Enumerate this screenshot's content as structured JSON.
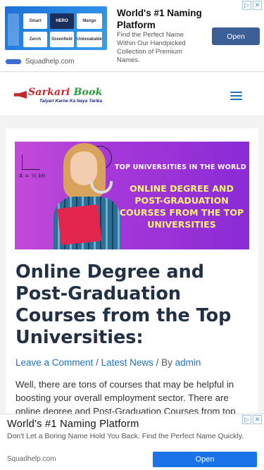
{
  "ad_top": {
    "title": "World's #1 Naming Platform",
    "description": "Find the Perfect Name Within Our Handpicked Collection of Premium Names.",
    "cta": "Open",
    "site": "Squadhelp.com",
    "thumb_tiles": [
      "Smart",
      "HERO",
      "Mango",
      "Zerch",
      "Greenfield",
      "Unbreakable"
    ],
    "adchoice_icons": [
      "info-icon",
      "close-icon"
    ]
  },
  "header": {
    "logo_name_a": "Sarkari ",
    "logo_name_b": "Book",
    "logo_tagline": "Taiyari Karne Ka Naya Tarika",
    "menu_icon": "hamburger-icon",
    "accent": "#1e73be"
  },
  "article": {
    "hero_top_text": "TOP UNIVERSITIES IN THE WORLD",
    "hero_main_text": "ONLINE DEGREE AND POST-GRADUATION COURSES FROM THE TOP UNIVERSITIES",
    "headline": "Online Degree and Post-Graduation Courses from the Top Universities:",
    "comment_link": "Leave a Comment",
    "separator_1": " / ",
    "category_link": "Latest News",
    "by_text": " / By ",
    "author_link": "admin",
    "body": "Well, there are tons of courses that may be helpful in boosting your overall employment sector. There are online degree and Post-Graduation Courses from top"
  },
  "ad_bottom": {
    "title": "World's #1 Naming Platform",
    "description": "Don't Let a Boring Name Hold You Back. Find the Perfect Name Quickly.",
    "site": "Squadhelp.com",
    "cta": "Open",
    "cta_color": "#1a73e8"
  }
}
